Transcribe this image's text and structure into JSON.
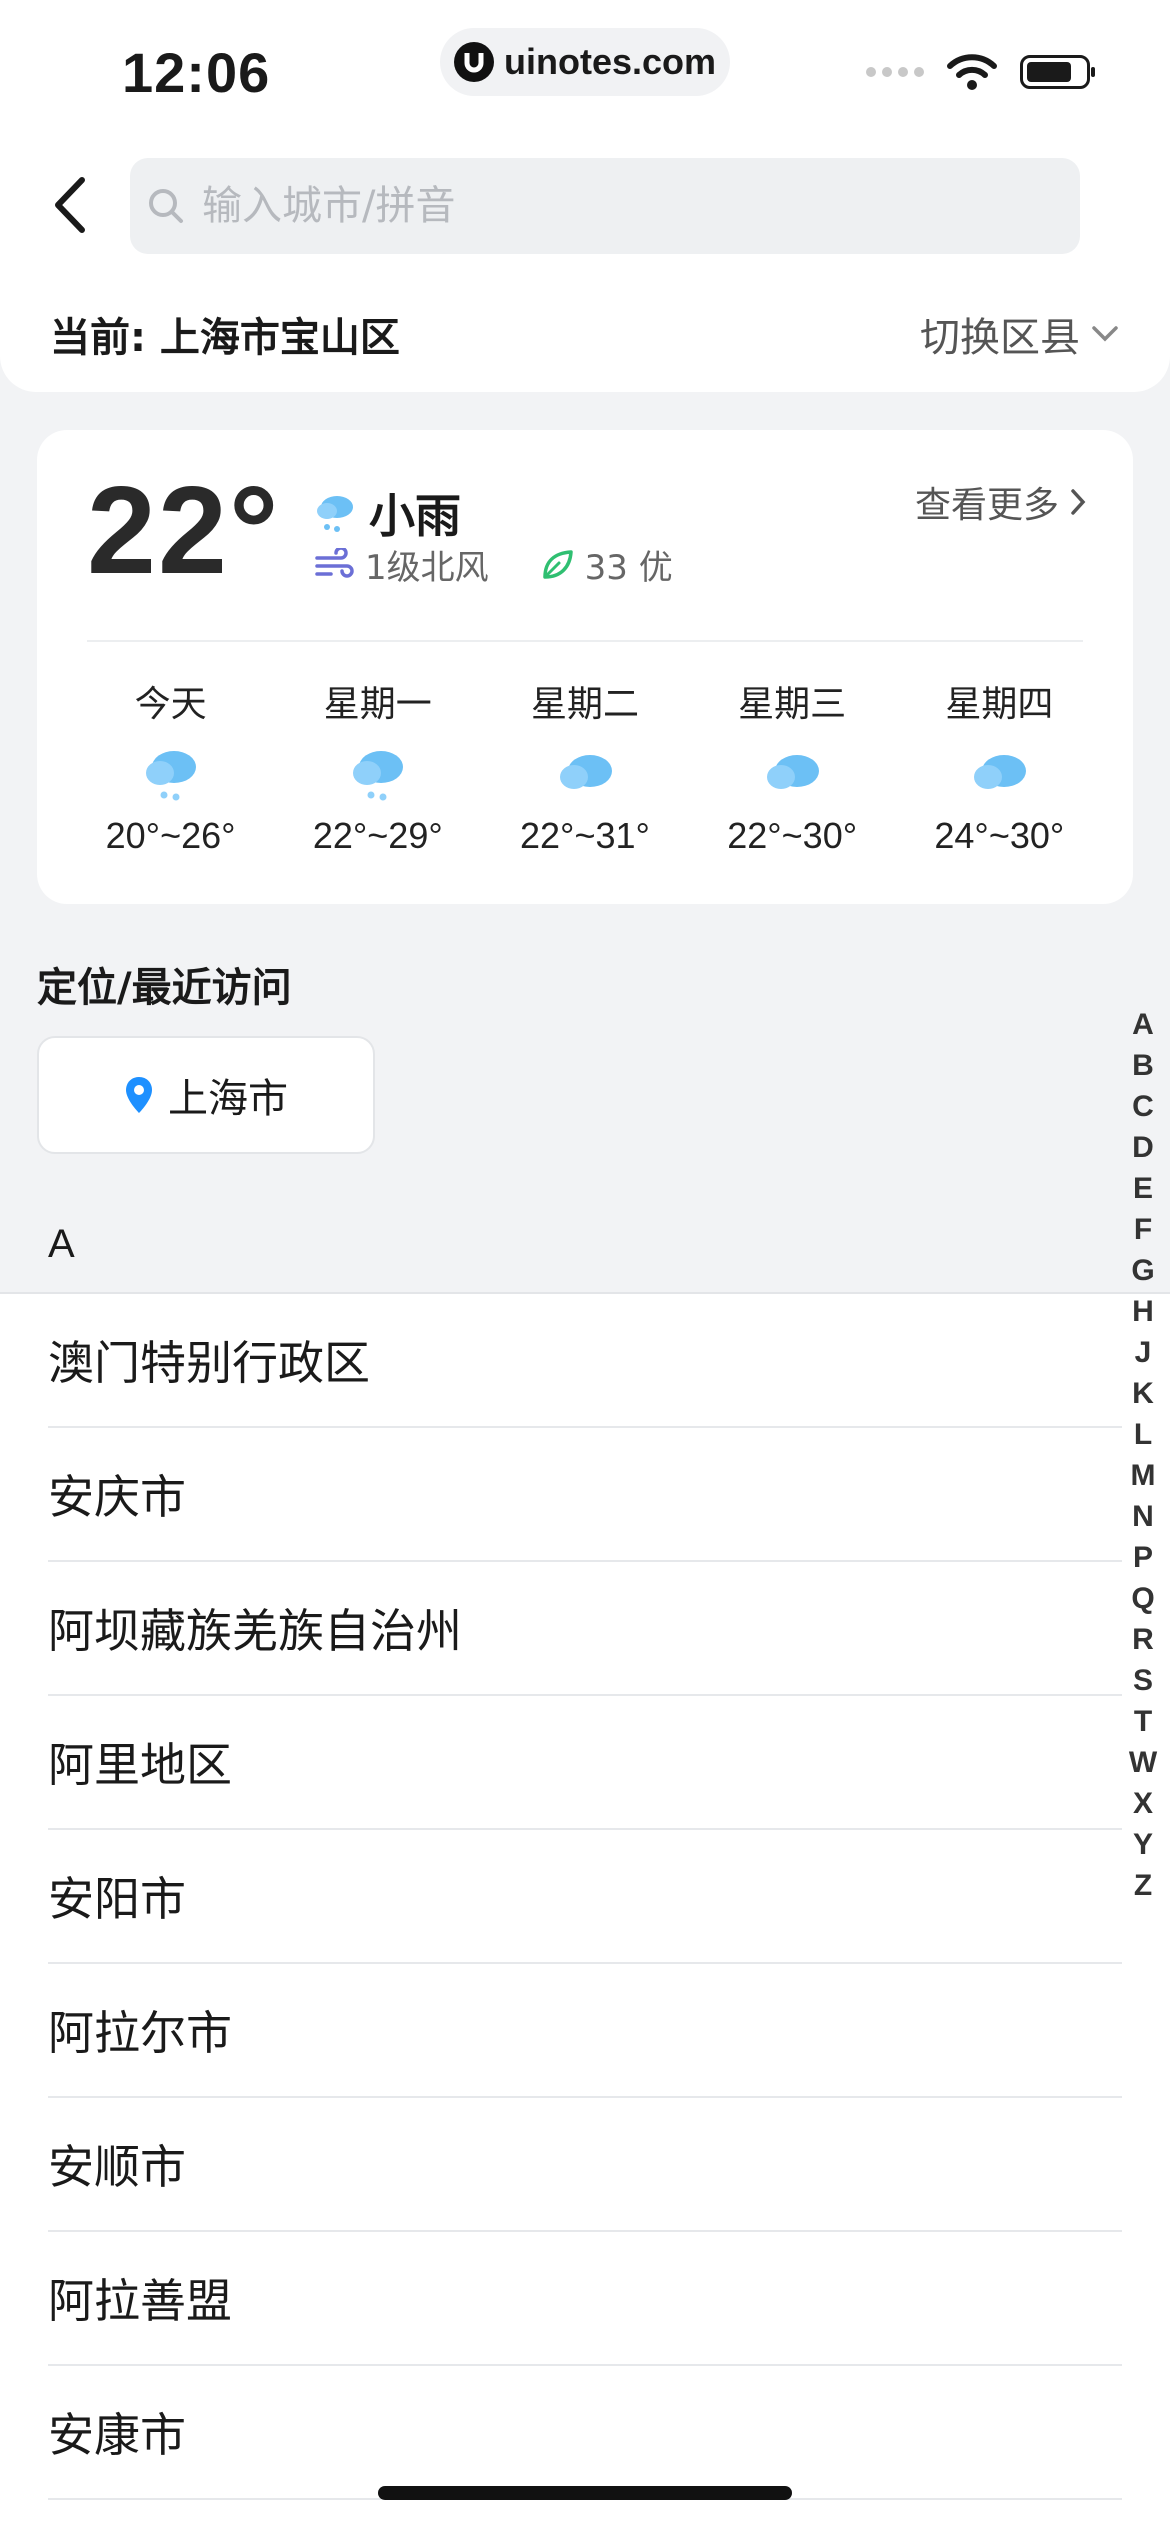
{
  "status_bar": {
    "time": "12:06",
    "url": "uinotes.com"
  },
  "search": {
    "placeholder": "输入城市/拼音",
    "value": ""
  },
  "current": {
    "label": "当前: 上海市宝山区",
    "switch_label": "切换区县"
  },
  "weather": {
    "temperature": "22°",
    "condition": "小雨",
    "wind": "1级北风",
    "air_quality": "33 优",
    "see_more": "查看更多",
    "forecast": [
      {
        "day": "今天",
        "range": "20°~26°",
        "icon": "rain-cloud-icon"
      },
      {
        "day": "星期一",
        "range": "22°~29°",
        "icon": "rain-cloud-icon"
      },
      {
        "day": "星期二",
        "range": "22°~31°",
        "icon": "cloud-icon"
      },
      {
        "day": "星期三",
        "range": "22°~30°",
        "icon": "cloud-icon"
      },
      {
        "day": "星期四",
        "range": "24°~30°",
        "icon": "cloud-icon"
      }
    ]
  },
  "recent": {
    "title": "定位/最近访问",
    "location_chip": "上海市"
  },
  "city_section": {
    "header": "A",
    "cities": [
      "澳门特别行政区",
      "安庆市",
      "阿坝藏族羌族自治州",
      "阿里地区",
      "安阳市",
      "阿拉尔市",
      "安顺市",
      "阿拉善盟",
      "安康市"
    ]
  },
  "index_letters": [
    "A",
    "B",
    "C",
    "D",
    "E",
    "F",
    "G",
    "H",
    "J",
    "K",
    "L",
    "M",
    "N",
    "P",
    "Q",
    "R",
    "S",
    "T",
    "W",
    "X",
    "Y",
    "Z"
  ],
  "colors": {
    "accent_blue": "#1e90ff",
    "leaf_green": "#2fbf71",
    "wind_purple": "#6b6fd6",
    "cloud_blue": "#6cc0f5"
  }
}
